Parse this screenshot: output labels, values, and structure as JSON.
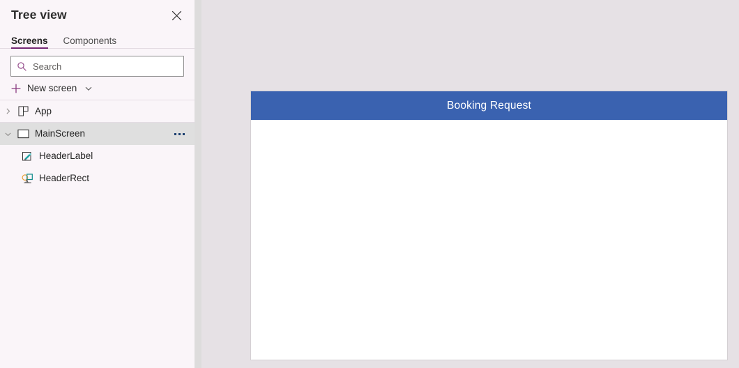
{
  "panel": {
    "title": "Tree view",
    "close_icon": "close-icon",
    "tabs": [
      {
        "label": "Screens",
        "active": true
      },
      {
        "label": "Components",
        "active": false
      }
    ],
    "search": {
      "placeholder": "Search",
      "value": "",
      "icon": "search-icon"
    },
    "new_screen": {
      "label": "New screen",
      "plus_icon": "plus-icon",
      "chevron_icon": "chevron-down-icon"
    },
    "tree": [
      {
        "label": "App",
        "icon": "app-grid-icon",
        "twisty": "chevron-right-icon",
        "expanded": false,
        "selected": false,
        "level": 1
      },
      {
        "label": "MainScreen",
        "icon": "screen-rect-icon",
        "twisty": "chevron-down-icon",
        "expanded": true,
        "selected": true,
        "level": 1,
        "overflow": "more-options-icon"
      },
      {
        "label": "HeaderLabel",
        "icon": "label-pencil-icon",
        "selected": false,
        "level": 2
      },
      {
        "label": "HeaderRect",
        "icon": "shapes-icon",
        "selected": false,
        "level": 2
      }
    ]
  },
  "canvas": {
    "header_rect": {
      "name": "HeaderRect",
      "fill": "#3A62B0"
    },
    "header_label": {
      "name": "HeaderLabel",
      "text": "Booking Request",
      "color": "#FFFFFF"
    },
    "screen_background": "#FFFFFF",
    "stage_background": "#E6E1E5"
  },
  "colors": {
    "accent_purple": "#742774",
    "panel_background": "#FAF5F9",
    "selected_row": "#DFDFDF",
    "header_blue": "#3A62B0"
  }
}
